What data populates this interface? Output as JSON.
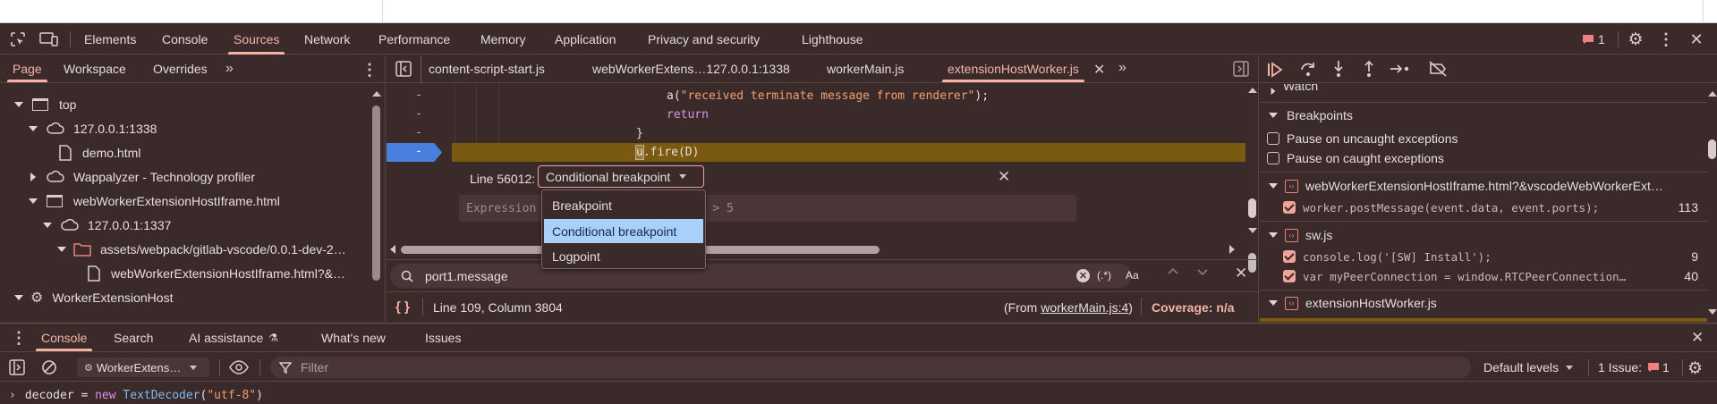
{
  "toolbar": {
    "tabs": [
      "Elements",
      "Console",
      "Sources",
      "Network",
      "Performance",
      "Memory",
      "Application",
      "Privacy and security",
      "Lighthouse"
    ],
    "active_tab": "Sources",
    "issues_count": "1"
  },
  "navigator": {
    "tabs": [
      "Page",
      "Workspace",
      "Overrides"
    ],
    "active_tab": "Page",
    "tree": [
      {
        "label": "top"
      },
      {
        "label": "127.0.0.1:1338"
      },
      {
        "label": "demo.html"
      },
      {
        "label": "Wappalyzer - Technology profiler"
      },
      {
        "label": "webWorkerExtensionHostIframe.html"
      },
      {
        "label": "127.0.0.1:1337"
      },
      {
        "label": "assets/webpack/gitlab-vscode/0.0.1-dev-2…"
      },
      {
        "label": "webWorkerExtensionHostIframe.html?&…"
      },
      {
        "label": "WorkerExtensionHost"
      }
    ]
  },
  "editor": {
    "tabs": [
      "content-script-start.js",
      "webWorkerExtens…127.0.0.1:1338",
      "workerMain.js",
      "extensionHostWorker.js"
    ],
    "active_tab": "extensionHostWorker.js",
    "code_lines": [
      {
        "num": "-",
        "text_fn": "a(",
        "text_str": "\"received terminate message from renderer\"",
        "text_end": ");"
      },
      {
        "num": "-",
        "text_kw": "return"
      },
      {
        "num": "-",
        "text": "}"
      },
      {
        "num": "-",
        "text_cursor": "u",
        "text_rest": ".fire(D)"
      }
    ],
    "breakpoint_editor": {
      "line_label": "Line 56012:",
      "type_selected": "Conditional breakpoint",
      "placeholder": "Expression to check before pausing, e.g. x > 5",
      "visible_left": "Expression",
      "visible_right": "ng, e.g. x > 5",
      "options": [
        "Breakpoint",
        "Conditional breakpoint",
        "Logpoint"
      ],
      "highlighted_option": "Conditional breakpoint"
    },
    "search": {
      "value": "port1.message",
      "regex_label": "(.*)",
      "case_label": "Aa"
    },
    "status": {
      "position": "Line 109, Column 3804",
      "from_prefix": "(From ",
      "from_link": "workerMain.js:4",
      "from_suffix": ")",
      "coverage": "Coverage: n/a"
    }
  },
  "debugger": {
    "watch_label": "Watch",
    "breakpoints_label": "Breakpoints",
    "pause_uncaught": "Pause on uncaught exceptions",
    "pause_caught": "Pause on caught exceptions",
    "groups": [
      {
        "file": "webWorkerExtensionHostIframe.html?&vscodeWebWorkerExt…",
        "items": [
          {
            "code": "worker.postMessage(event.data, event.ports);",
            "line": "113"
          }
        ]
      },
      {
        "file": "sw.js",
        "items": [
          {
            "code": "console.log('[SW] Install');",
            "line": "9"
          },
          {
            "code": "var myPeerConnection = window.RTCPeerConnection…",
            "line": "40"
          }
        ]
      },
      {
        "file": "extensionHostWorker.js",
        "items": []
      }
    ]
  },
  "drawer": {
    "tabs": [
      "Console",
      "Search",
      "AI assistance",
      "What's new",
      "Issues"
    ],
    "active_tab": "Console",
    "context": "WorkerExtens…",
    "filter_placeholder": "Filter",
    "levels": "Default levels",
    "issues_label": "1 Issue:",
    "issues_count": "1",
    "prompt_line": {
      "pre": "decoder = ",
      "kw": "new",
      "cls": " TextDecoder",
      "open": "(",
      "str": "\"utf-8\"",
      "close": ")"
    }
  },
  "colors": {
    "background": "#3a2a2a",
    "accent": "#f5b3a8",
    "highlight_line": "#7a5a10",
    "dropdown_selected": "#a8d0f8",
    "breakpoint_marker": "#4a7fe0"
  }
}
